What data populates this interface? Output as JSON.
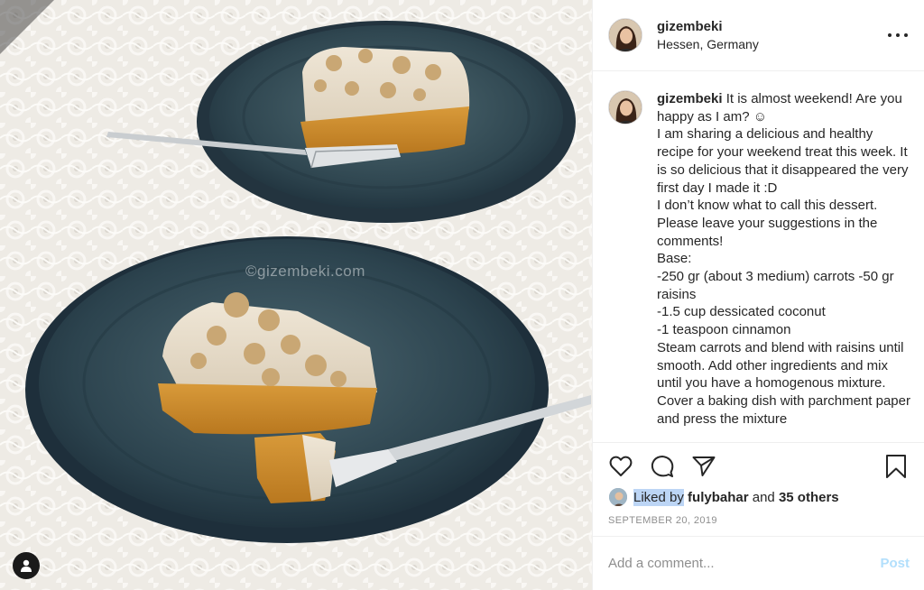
{
  "post": {
    "username": "gizembeki",
    "location": "Hessen, Germany",
    "watermark": "©gizembeki.com",
    "caption_username": "gizembeki",
    "caption_text": " It is almost weekend! Are you happy as I am? ☺\nI am sharing a delicious and healthy recipe for your weekend treat this week. It is so delicious that it disappeared the very first day I made it :D\nI don’t know what to call this dessert. Please leave your suggestions in the comments!\nBase:\n-250 gr (about 3 medium) carrots -50 gr raisins\n-1.5 cup dessicated coconut\n-1 teaspoon cinnamon\nSteam carrots and blend with raisins until smooth. Add other ingredients and mix until you have a homogenous mixture. Cover a baking dish with parchment paper and press the mixture",
    "liked_by_label": "Liked by",
    "liked_by_user": "fulybahar",
    "and_label": "and",
    "others_label": "35 others",
    "date": "SEPTEMBER 20, 2019",
    "comment_placeholder": "Add a comment...",
    "post_button": "Post"
  },
  "icons": {
    "like": "heart-icon",
    "comment": "comment-icon",
    "share": "paper-plane-icon",
    "save": "bookmark-icon",
    "more": "more-options-icon",
    "user_tags": "user-tag-icon"
  },
  "colors": {
    "accent_disabled": "#b2dffc",
    "secondary_text": "#8e8e8e",
    "highlight": "#bcd5f5",
    "border": "#efefef"
  }
}
